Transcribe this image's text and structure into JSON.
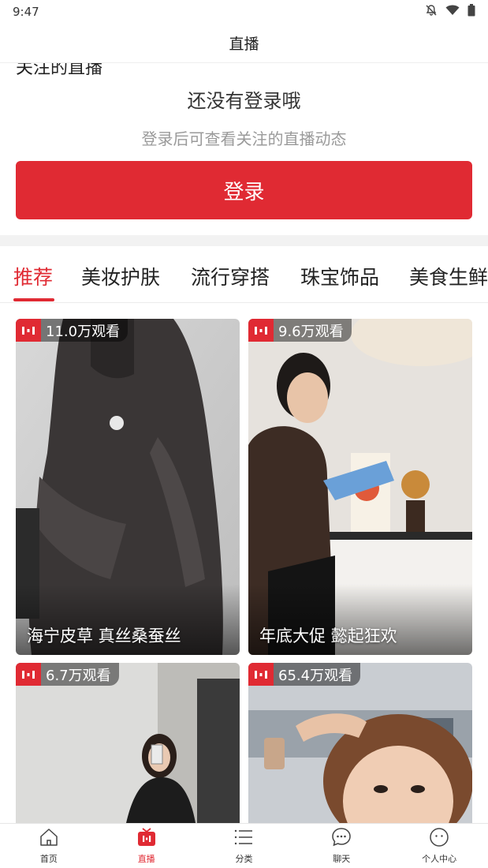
{
  "status_bar": {
    "time": "9:47",
    "icons": [
      "mute-bell-icon",
      "wifi-icon",
      "battery-icon"
    ]
  },
  "header": {
    "title": "直播"
  },
  "login_section": {
    "cut_heading": "关注的直播",
    "title": "还没有登录哦",
    "subtitle": "登录后可查看关注的直播动态",
    "button_label": "登录"
  },
  "tabs": [
    {
      "label": "推荐",
      "active": true
    },
    {
      "label": "美妆护肤",
      "active": false
    },
    {
      "label": "流行穿搭",
      "active": false
    },
    {
      "label": "珠宝饰品",
      "active": false
    },
    {
      "label": "美食生鲜",
      "active": false
    }
  ],
  "live_cards": [
    {
      "viewers": "11.0万观看",
      "title": "海宁皮草 真丝桑蚕丝"
    },
    {
      "viewers": "9.6万观看",
      "title": "年底大促 懿起狂欢"
    },
    {
      "viewers": "6.7万观看",
      "title": ""
    },
    {
      "viewers": "65.4万观看",
      "title": ""
    }
  ],
  "bottom_nav": [
    {
      "label": "首页",
      "icon": "home-icon",
      "active": false
    },
    {
      "label": "直播",
      "icon": "live-tv-icon",
      "active": true
    },
    {
      "label": "分类",
      "icon": "category-list-icon",
      "active": false
    },
    {
      "label": "聊天",
      "icon": "chat-bubble-icon",
      "active": false
    },
    {
      "label": "个人中心",
      "icon": "profile-face-icon",
      "active": false
    }
  ],
  "colors": {
    "accent": "#e02a33",
    "subtitle_gray": "#9a9a9a",
    "divider": "#f2f2f2"
  }
}
